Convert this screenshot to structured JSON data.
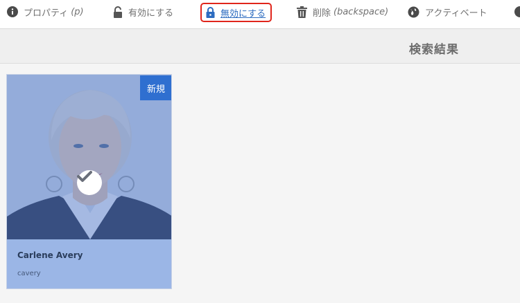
{
  "toolbar": {
    "properties": {
      "label": "プロパティ",
      "hint": "(p)",
      "icon": "info-icon"
    },
    "enable": {
      "label": "有効にする",
      "icon": "unlock-icon"
    },
    "disable": {
      "label": "無効にする",
      "icon": "lock-icon"
    },
    "delete": {
      "label": "削除",
      "hint": "(backspace)",
      "icon": "trash-icon"
    },
    "activate": {
      "label": "アクティベート",
      "icon": "globe-icon"
    }
  },
  "results": {
    "title": "検索結果"
  },
  "card": {
    "badge": "新規",
    "name": "Carlene Avery",
    "username": "cavery",
    "selected": true
  },
  "colors": {
    "highlight_border": "#e0251b",
    "link": "#2d6cc0",
    "badge": "#2f6fd0",
    "card_info": "#9bb6e6"
  }
}
